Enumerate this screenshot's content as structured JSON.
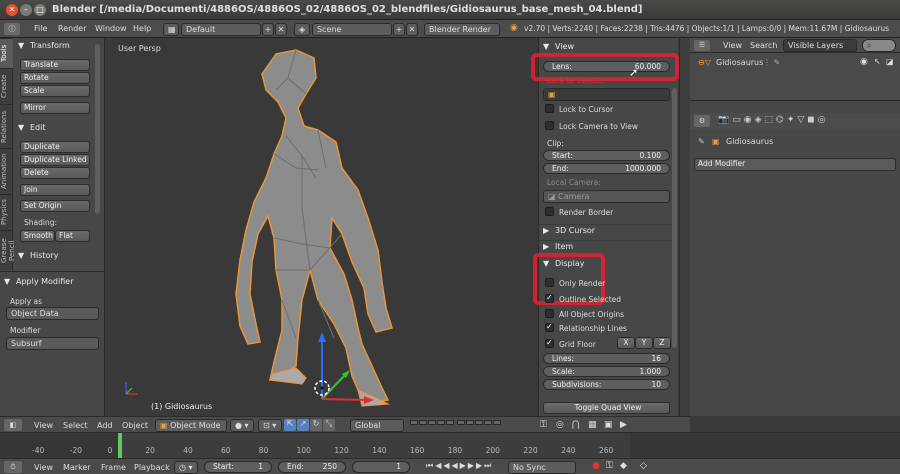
{
  "window": {
    "title": "Blender [/media/Documenti/4886OS/4886OS_02/4886OS_02_blendfiles/Gidiosaurus_base_mesh_04.blend]"
  },
  "infobar": {
    "menus": [
      "File",
      "Render",
      "Window",
      "Help"
    ],
    "layout": "Default",
    "scene": "Scene",
    "engine": "Blender Render",
    "stats": "v2.70 | Verts:2240 | Faces:2238 | Tris:4476 | Objects:1/1 | Lamps:0/0 | Mem:11.67M | Gidiosaurus"
  },
  "tools": {
    "tabs": [
      "Tools",
      "Create",
      "Relations",
      "Animation",
      "Physics",
      "Grease Pencil"
    ],
    "transform": {
      "header": "Transform",
      "buttons": [
        "Translate",
        "Rotate",
        "Scale",
        "Mirror"
      ]
    },
    "edit": {
      "header": "Edit",
      "buttons": [
        "Duplicate",
        "Duplicate Linked",
        "Delete",
        "Join"
      ],
      "set_origin": "Set Origin",
      "shading_label": "Shading:",
      "smooth": "Smooth",
      "flat": "Flat"
    },
    "history": {
      "header": "History"
    },
    "operator": {
      "header": "Apply Modifier",
      "apply_as_label": "Apply as",
      "apply_as": "Object Data",
      "modifier_label": "Modifier",
      "modifier": "Subsurf"
    }
  },
  "viewport": {
    "view_label": "User Persp",
    "object_label": "(1) Gidiosaurus"
  },
  "npanel": {
    "view": {
      "header": "View",
      "lens_label": "Lens:",
      "lens_value": "60.000",
      "lock_to_object": "Lock to Object:",
      "lock_cursor": "Lock to Cursor",
      "lock_camera": "Lock Camera to View",
      "clip_label": "Clip:",
      "clip_start_label": "Start:",
      "clip_start": "0.100",
      "clip_end_label": "End:",
      "clip_end": "1000.000",
      "local_camera": "Local Camera:",
      "camera": "Camera",
      "render_border": "Render Border"
    },
    "sections": [
      "3D Cursor",
      "Item"
    ],
    "display": {
      "header": "Display",
      "only_render": "Only Render",
      "outline_selected": "Outline Selected",
      "all_object_origins": "All Object Origins",
      "relationship_lines": "Relationship Lines",
      "grid_floor": "Grid Floor",
      "axes": [
        "X",
        "Y",
        "Z"
      ],
      "lines_label": "Lines:",
      "lines": "16",
      "scale_label": "Scale:",
      "scale": "1.000",
      "subdivisions_label": "Subdivisions:",
      "subdivisions": "10"
    },
    "toggle_quad": "Toggle Quad View"
  },
  "outliner": {
    "menus": [
      "View",
      "Search"
    ],
    "filter": "Visible Layers",
    "item": "Gidiosaurus"
  },
  "properties": {
    "object": "Gidiosaurus",
    "add_modifier": "Add Modifier"
  },
  "header3d": {
    "menus": [
      "View",
      "Select",
      "Add",
      "Object"
    ],
    "mode": "Object Mode",
    "orientation": "Global"
  },
  "timeline": {
    "ticks": [
      "-40",
      "-20",
      "0",
      "20",
      "40",
      "60",
      "80",
      "100",
      "120",
      "140",
      "160",
      "180",
      "200",
      "220",
      "240",
      "260"
    ],
    "current_frame": 1
  },
  "timeline_header": {
    "menus": [
      "View",
      "Marker",
      "Frame",
      "Playback"
    ],
    "start_label": "Start:",
    "start": "1",
    "end_label": "End:",
    "end": "250",
    "frame": "1",
    "sync": "No Sync"
  }
}
